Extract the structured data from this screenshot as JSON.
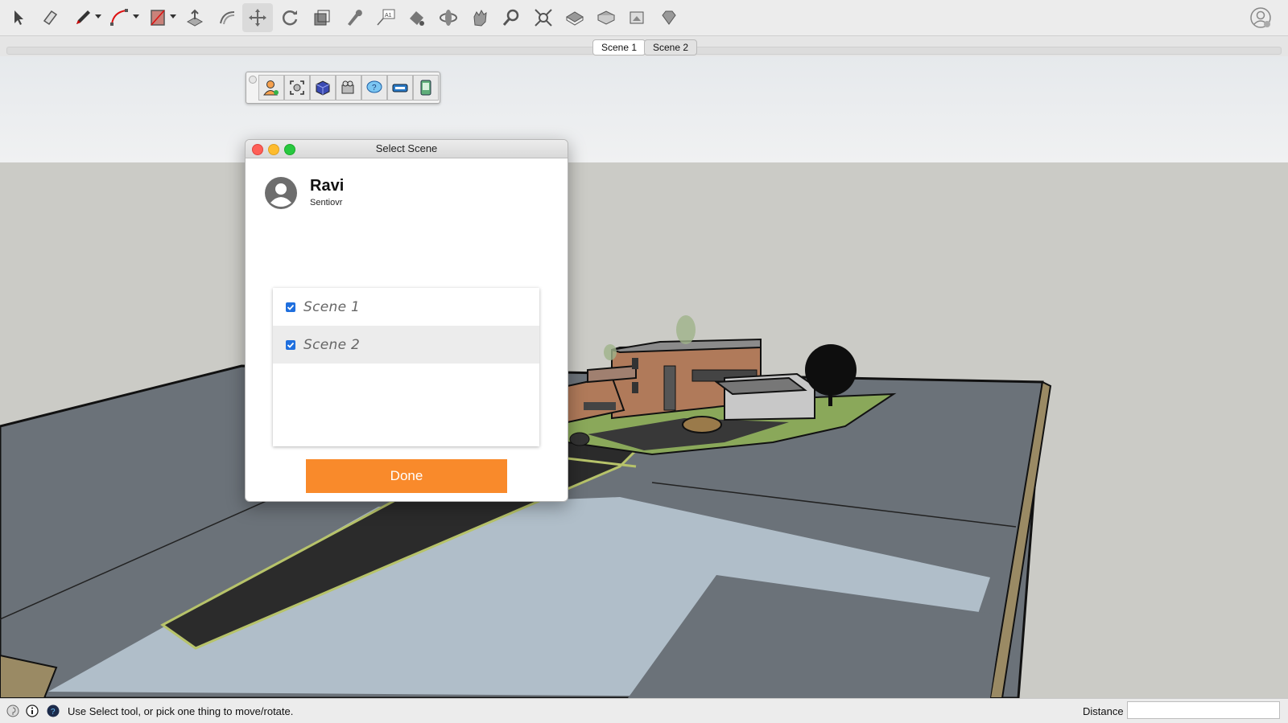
{
  "toolbar": {
    "tools": [
      {
        "name": "select-tool",
        "icon": "arrow-icon"
      },
      {
        "name": "eraser-tool",
        "icon": "eraser-icon"
      },
      {
        "name": "line-tool",
        "icon": "pencil-icon"
      },
      {
        "name": "arc-tool",
        "icon": "arc-icon"
      },
      {
        "name": "rectangle-tool",
        "icon": "rectangle-icon"
      },
      {
        "name": "push-pull-tool",
        "icon": "push-pull-icon"
      },
      {
        "name": "offset-tool",
        "icon": "offset-icon"
      },
      {
        "name": "move-tool",
        "icon": "move-icon",
        "active": true
      },
      {
        "name": "rotate-tool",
        "icon": "rotate-icon"
      },
      {
        "name": "scale-tool",
        "icon": "scale-icon"
      },
      {
        "name": "tape-measure-tool",
        "icon": "tape-icon"
      },
      {
        "name": "text-tool",
        "icon": "text-icon"
      },
      {
        "name": "paint-bucket-tool",
        "icon": "paint-bucket-icon"
      },
      {
        "name": "orbit-tool",
        "icon": "orbit-icon"
      },
      {
        "name": "pan-tool",
        "icon": "hand-icon"
      },
      {
        "name": "zoom-tool",
        "icon": "magnifier-icon"
      },
      {
        "name": "zoom-extents-tool",
        "icon": "zoom-extents-icon"
      },
      {
        "name": "warehouse-tool",
        "icon": "warehouse-icon"
      },
      {
        "name": "extension-warehouse-tool",
        "icon": "extension-warehouse-icon"
      },
      {
        "name": "layout-tool",
        "icon": "layout-icon"
      },
      {
        "name": "extension-manager-tool",
        "icon": "ruby-icon"
      }
    ]
  },
  "scene_tabs": [
    "Scene 1",
    "Scene 2"
  ],
  "plugin_toolbar": {
    "buttons": [
      "user-icon",
      "focus-icon",
      "cube-icon",
      "camera-icon",
      "help-bubble-icon",
      "vr-headset-icon",
      "phone-icon"
    ]
  },
  "dialog": {
    "title": "Select Scene",
    "user_name": "Ravi",
    "user_org": "Sentiovr",
    "scenes": [
      {
        "label": "Scene 1",
        "checked": true
      },
      {
        "label": "Scene 2",
        "checked": true
      }
    ],
    "done_label": "Done"
  },
  "statusbar": {
    "message": "Use Select tool, or pick one thing to move/rotate.",
    "distance_label": "Distance",
    "distance_value": ""
  },
  "colors": {
    "accent": "#f98a2b",
    "checkbox": "#1f6fde",
    "ground": "#6b7279",
    "sky": "#e8ebee"
  }
}
